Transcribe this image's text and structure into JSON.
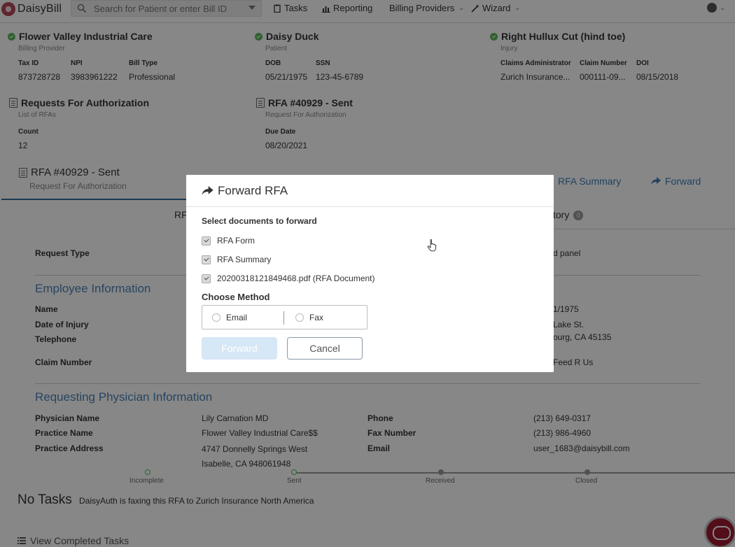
{
  "navbar": {
    "logo_text": "DaisyBill",
    "search_placeholder": "Search for Patient or enter Bill ID",
    "tasks": "Tasks",
    "reporting": "Reporting",
    "billing_providers": "Billing Providers",
    "wizard": "Wizard"
  },
  "provider": {
    "title": "Flower Valley Industrial Care",
    "subtitle": "Billing Provider",
    "tax_id_label": "Tax ID",
    "tax_id": "873728728",
    "npi_label": "NPI",
    "npi": "3983961222",
    "bill_type_label": "Bill Type",
    "bill_type": "Professional"
  },
  "patient": {
    "title": "Daisy Duck",
    "subtitle": "Patient",
    "dob_label": "DOB",
    "dob": "05/21/1975",
    "ssn_label": "SSN",
    "ssn": "123-45-6789"
  },
  "injury": {
    "title": "Right Hullux Cut (hind toe)",
    "subtitle": "Injury",
    "admin_label": "Claims Administrator",
    "admin": "Zurich Insurance...",
    "claim_label": "Claim Number",
    "claim": "000111-09...",
    "doi_label": "DOI",
    "doi": "08/15/2018"
  },
  "rfa_list": {
    "title": "Requests For Authorization",
    "subtitle": "List of RFAs",
    "count_label": "Count",
    "count": "12"
  },
  "rfa_current": {
    "title": "RFA #40929 - Sent",
    "subtitle": "Request For Authorization",
    "due_label": "Due Date",
    "due": "08/20/2021"
  },
  "page_header": {
    "title": "RFA #40929 - Sent",
    "subtitle": "Request For Authorization",
    "summary_link": "RFA Summary",
    "forward_link": "Forward",
    "tab_left_fragment": "RF",
    "tab_right_fragment": "tory",
    "tab_badge": "0"
  },
  "details": {
    "request_type_label": "Request Type",
    "request_type_fragment": "d panel",
    "employee_section": "Employee Information",
    "name_label": "Name",
    "doi_label": "Date of Injury",
    "telephone_label": "Telephone",
    "claim_label": "Claim Number",
    "dob_fragment": "1/1975",
    "address_fragment_1": "Lake St.",
    "address_fragment_2": "ourg, CA 45135",
    "employer_fragment": "Feed R Us",
    "physician_section": "Requesting Physician Information",
    "physician_name_label": "Physician Name",
    "physician_name": "Lily Carnation MD",
    "practice_name_label": "Practice Name",
    "practice_name": "Flower Valley Industrial Care$$",
    "practice_address_label": "Practice Address",
    "practice_address_1": "4747 Donnelly Springs West",
    "practice_address_2": "Isabelle, CA 948061948",
    "phone_label": "Phone",
    "phone": "(213) 649-0317",
    "fax_label": "Fax Number",
    "fax": "(213) 986-4960",
    "email_label": "Email",
    "email": "user_1683@daisybill.com"
  },
  "progress": {
    "steps": [
      "Incomplete",
      "Sent",
      "Received",
      "Closed"
    ]
  },
  "tasks": {
    "title": "No Tasks",
    "message": "DaisyAuth is faxing this RFA to Zurich Insurance North America",
    "view_completed": "View Completed Tasks"
  },
  "modal": {
    "title": "Forward RFA",
    "select_label": "Select documents to forward",
    "documents": [
      {
        "label": "RFA Form",
        "checked": true
      },
      {
        "label": "RFA Summary",
        "checked": true
      },
      {
        "label": "20200318121849468.pdf (RFA Document)",
        "checked": true
      }
    ],
    "method_label": "Choose Method",
    "method_email": "Email",
    "method_fax": "Fax",
    "forward_button": "Forward",
    "cancel_button": "Cancel"
  },
  "colors": {
    "link_blue": "#3b7fb8",
    "section_blue": "#4d83b7",
    "success_green": "#5cb85c",
    "brand_red": "#9e1b32"
  }
}
